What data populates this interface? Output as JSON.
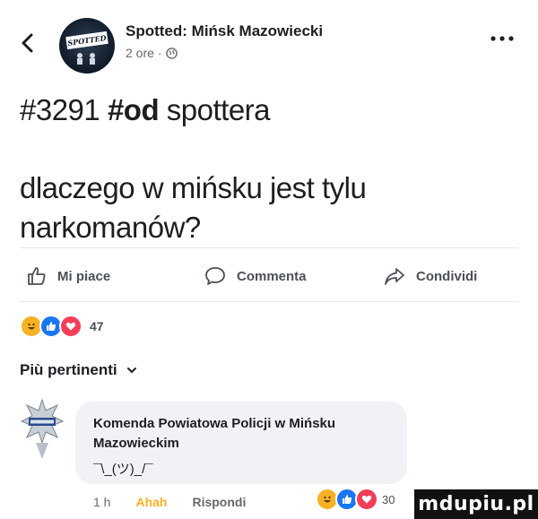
{
  "header": {
    "page_name": "Spotted: Mińsk Mazowiecki",
    "time": "2 ore",
    "dot": "·",
    "avatar_badge": "SPOTTED"
  },
  "post": {
    "tag_number": "#3291",
    "tag_bold": "#od",
    "tag_rest": "spottera",
    "text": "dlaczego w mińsku jest tylu narkomanów?"
  },
  "actions": {
    "like": "Mi piace",
    "comment": "Commenta",
    "share": "Condividi"
  },
  "reactions": {
    "count": "47",
    "types": [
      "haha",
      "like",
      "love"
    ],
    "colors": {
      "haha": "#f7b125",
      "like": "#1877f2",
      "love": "#f33e58"
    }
  },
  "comments_section": {
    "sort_label": "Più pertinenti"
  },
  "comment": {
    "author": "Komenda Powiatowa Policji w Mińsku Mazowieckim",
    "text": "¯\\_(ツ)_/¯",
    "time": "1 h",
    "reaction_word": "Ahah",
    "reply": "Rispondi",
    "reaction_count": "30"
  },
  "watermark": "mdupiu.pl"
}
